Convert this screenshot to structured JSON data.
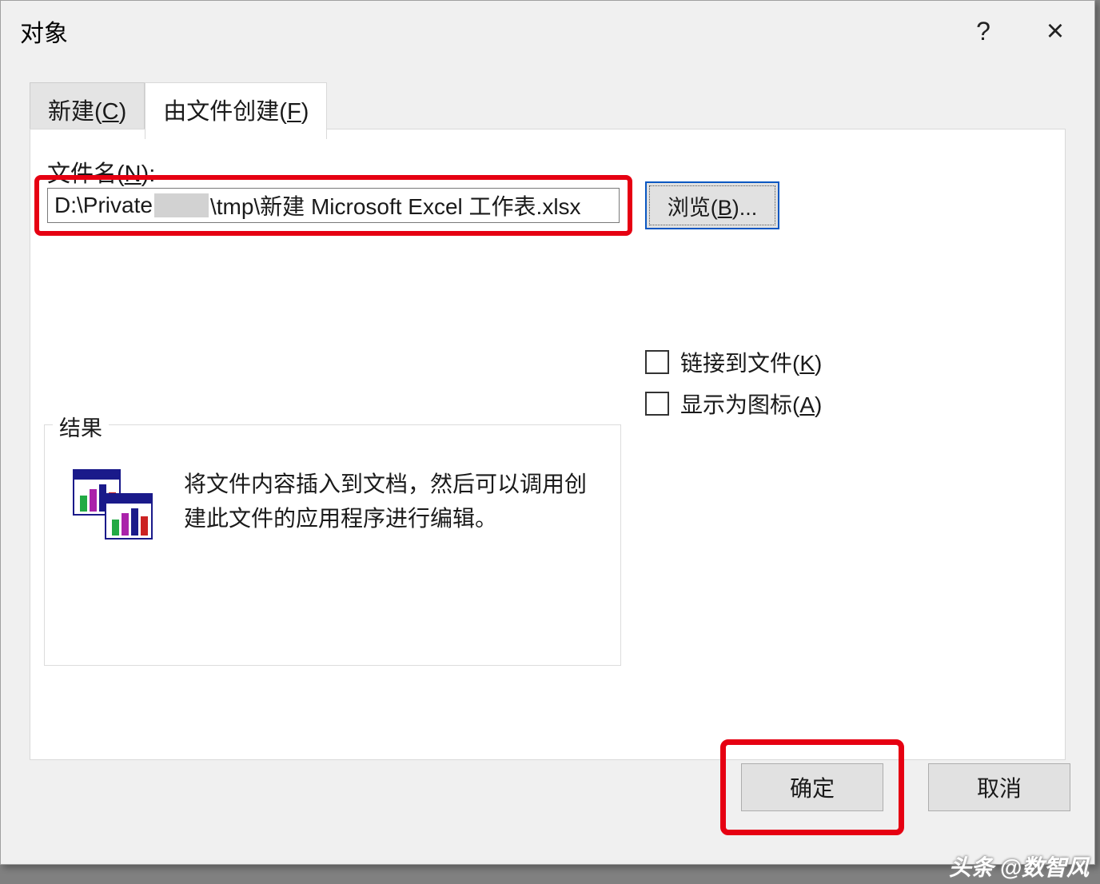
{
  "dialog": {
    "title": "对象",
    "help_tooltip": "?",
    "close_tooltip": "×"
  },
  "tabs": {
    "new_label": "新建(C)",
    "new_hotkey": "C",
    "fromfile_label": "由文件创建(F)",
    "fromfile_hotkey": "F"
  },
  "filefield": {
    "label_prefix": "文件名(",
    "label_hotkey": "N",
    "label_suffix": "):",
    "value_prefix": "D:\\Private",
    "value_suffix": "\\tmp\\新建 Microsoft Excel 工作表.xlsx"
  },
  "browse": {
    "label_prefix": "浏览(",
    "label_hotkey": "B",
    "label_suffix": ")..."
  },
  "checkboxes": {
    "link_prefix": "链接到文件(",
    "link_hotkey": "K",
    "link_suffix": ")",
    "icon_prefix": "显示为图标(",
    "icon_hotkey": "A",
    "icon_suffix": ")"
  },
  "result": {
    "legend": "结果",
    "description": "将文件内容插入到文档，然后可以调用创建此文件的应用程序进行编辑。"
  },
  "buttons": {
    "ok": "确定",
    "cancel": "取消"
  },
  "watermark": "头条 @数智风"
}
